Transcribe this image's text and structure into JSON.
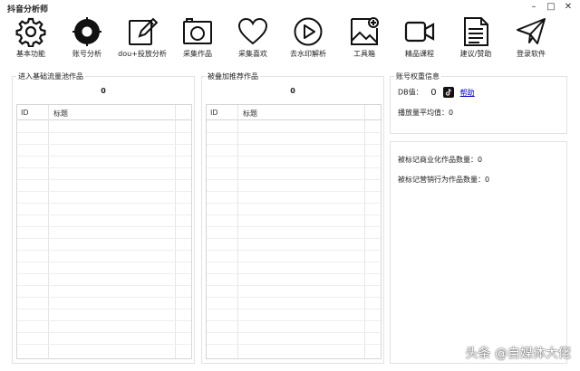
{
  "app": {
    "title": "抖音分析师"
  },
  "window": {
    "minimize": "–",
    "maximize": "□",
    "close": "✕"
  },
  "toolbar": {
    "items": [
      {
        "label": "基本功能",
        "icon": "gear-icon"
      },
      {
        "label": "账号分析",
        "icon": "target-icon"
      },
      {
        "label": "dou+投放分析",
        "icon": "edit-icon"
      },
      {
        "label": "采集作品",
        "icon": "camera-icon"
      },
      {
        "label": "采集喜欢",
        "icon": "heart-icon"
      },
      {
        "label": "去水印解析",
        "icon": "play-icon"
      },
      {
        "label": "工具箱",
        "icon": "image-add-icon"
      },
      {
        "label": "精品课程",
        "icon": "video-icon"
      },
      {
        "label": "建议/赞助",
        "icon": "document-icon"
      },
      {
        "label": "登录软件",
        "icon": "send-icon"
      }
    ]
  },
  "pool_panel": {
    "caption": "进入基础流量池作品",
    "count": "0",
    "columns": {
      "id": "ID",
      "title": "标题"
    }
  },
  "stacked_panel": {
    "caption": "被叠加推荐作品",
    "count": "0",
    "columns": {
      "id": "ID",
      "title": "标题"
    }
  },
  "weight_panel": {
    "caption": "账号权重信息",
    "db_label": "DB值：",
    "db_value": "0",
    "help": "帮助",
    "avg_play_label": "播放量平均值：",
    "avg_play_value": "0"
  },
  "marks_panel": {
    "commercial_label": "被标记商业化作品数量：",
    "commercial_value": "0",
    "marketing_label": "被标记营销行为作品数量：",
    "marketing_value": "0"
  },
  "watermark": "头条 @自媒体大佬",
  "colors": {
    "accent": "#111111",
    "link": "#0000cc",
    "border": "#e2e2e2"
  }
}
